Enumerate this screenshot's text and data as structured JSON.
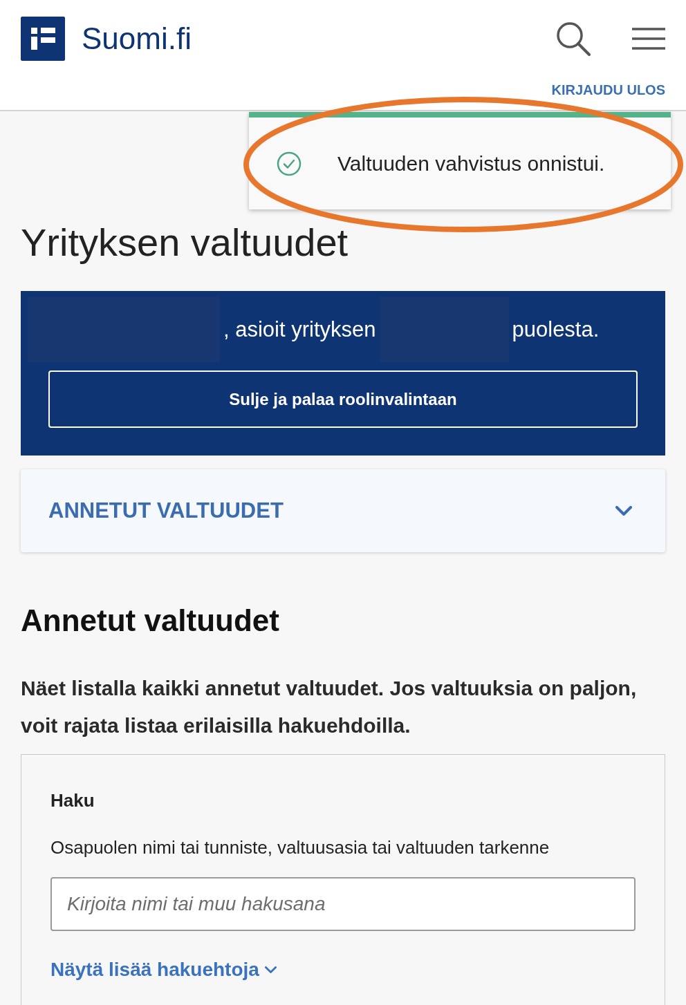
{
  "header": {
    "logo_text": "Suomi.fi",
    "logout_link": "KIRJAUDU ULOS"
  },
  "toast": {
    "kind": "success",
    "message": "Valtuuden vahvistus onnistui.",
    "highlighted": true
  },
  "page_title": "Yrityksen valtuudet",
  "role_banner": {
    "segments": [
      {
        "kind": "redacted"
      },
      {
        "kind": "text",
        "text": ", asioit yrityksen"
      },
      {
        "kind": "redacted"
      },
      {
        "kind": "text",
        "text": "puolesta."
      }
    ],
    "button": "Sulje ja palaa roolinvalintaan"
  },
  "accordion": {
    "title": "ANNETUT VALTUUDET",
    "expanded": false
  },
  "section": {
    "heading": "Annetut valtuudet",
    "description": "Näet listalla kaikki annetut valtuudet. Jos valtuuksia on paljon, voit rajata listaa erilaisilla hakuehdoilla."
  },
  "search_panel": {
    "title": "Haku",
    "field_label": "Osapuolen nimi tai tunniste, valtuusasia tai valtuuden tarkenne",
    "placeholder": "Kirjoita nimi tai muu hakusana",
    "more_link": "Näytä lisää hakuehtoja",
    "more_expanded": false
  }
}
